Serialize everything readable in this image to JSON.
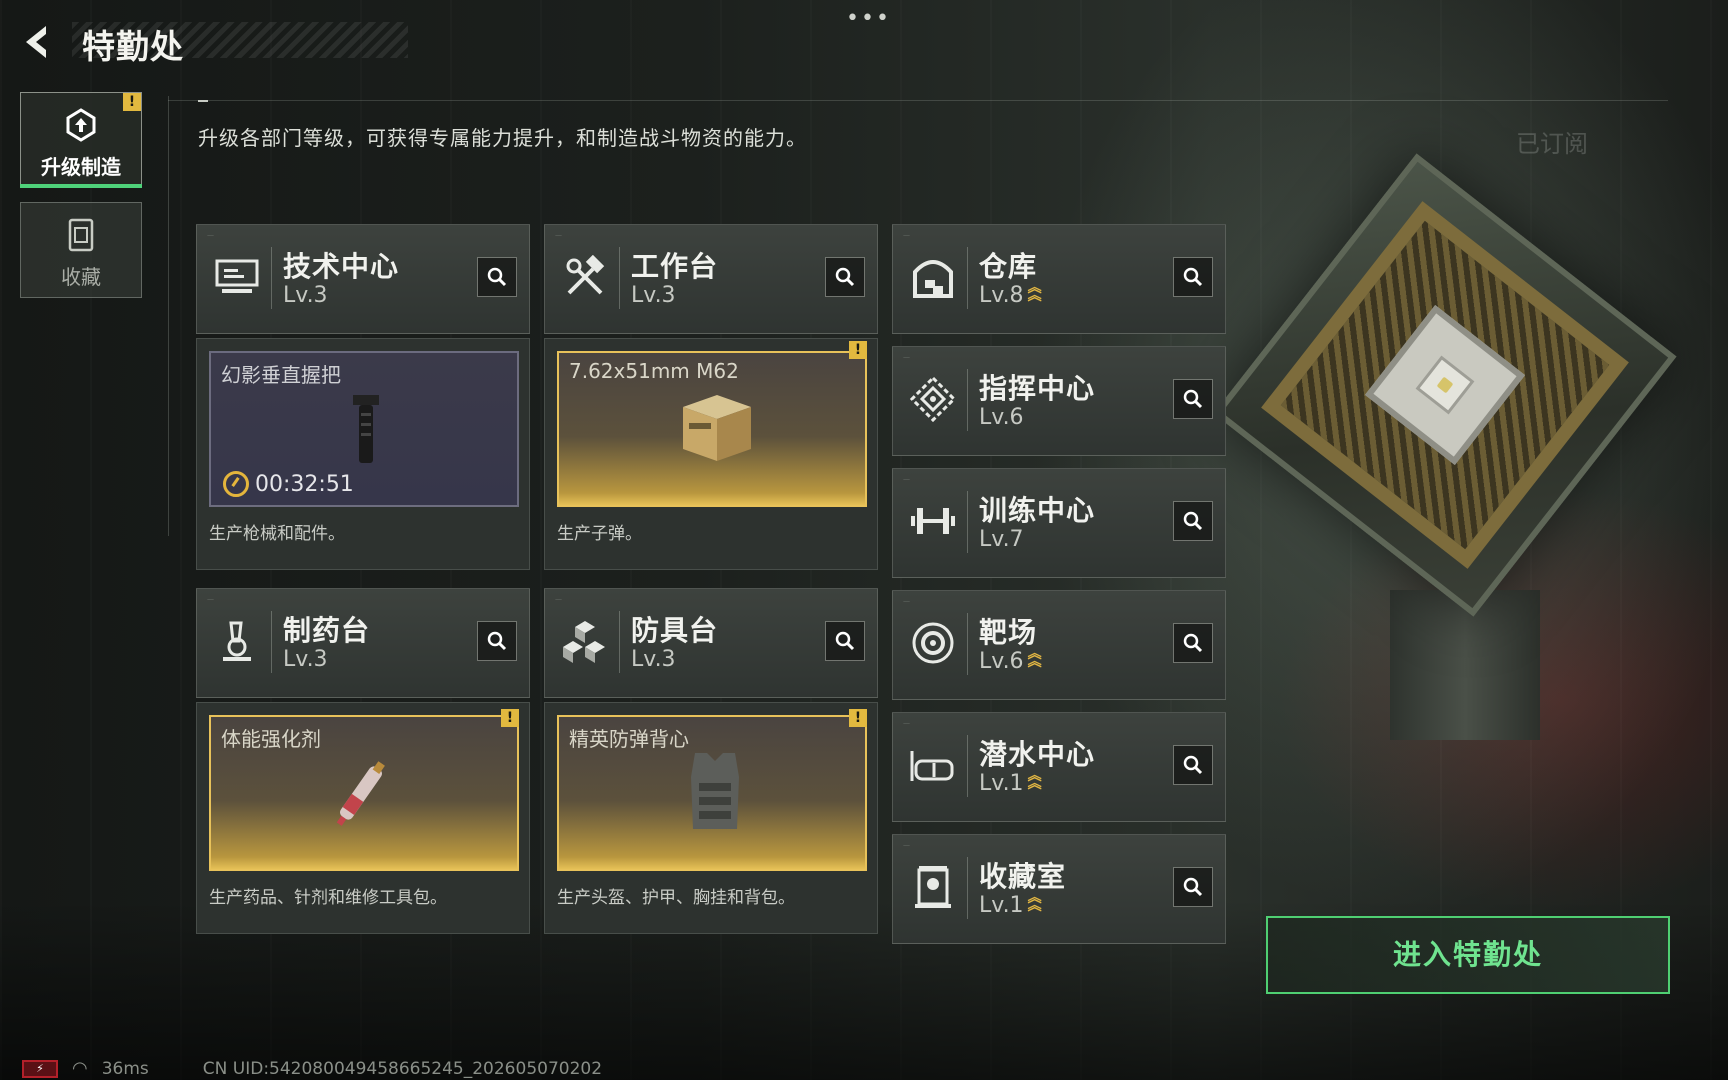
{
  "header": {
    "title": "特勤处",
    "more_label": "•••"
  },
  "nav": [
    {
      "label": "升级制造",
      "icon": "upgrade-gear-icon",
      "active": true,
      "badge": "!"
    },
    {
      "label": "收藏",
      "icon": "collection-jar-icon",
      "active": false
    }
  ],
  "description": "升级各部门等级，可获得专属能力提升，和制造战斗物资的能力。",
  "subscribed_label": "已订阅",
  "departments": {
    "tech": {
      "name": "技术中心",
      "level": "Lv.3",
      "icon": "computer-icon"
    },
    "workbench": {
      "name": "工作台",
      "level": "Lv.3",
      "icon": "hammer-wrench-icon"
    },
    "pharmacy": {
      "name": "制药台",
      "level": "Lv.3",
      "icon": "microscope-icon"
    },
    "armor": {
      "name": "防具台",
      "level": "Lv.3",
      "icon": "cubes-icon"
    },
    "storage": {
      "name": "仓库",
      "level": "Lv.8",
      "icon": "warehouse-icon",
      "upgradeable": true
    },
    "command": {
      "name": "指挥中心",
      "level": "Lv.6",
      "icon": "command-diamond-icon"
    },
    "training": {
      "name": "训练中心",
      "level": "Lv.7",
      "icon": "dumbbell-icon"
    },
    "range": {
      "name": "靶场",
      "level": "Lv.6",
      "icon": "target-icon",
      "upgradeable": true
    },
    "diving": {
      "name": "潜水中心",
      "level": "Lv.1",
      "icon": "diving-mask-icon",
      "upgradeable": true
    },
    "collection": {
      "name": "收藏室",
      "level": "Lv.1",
      "icon": "display-case-icon",
      "upgradeable": true
    }
  },
  "production": {
    "tech": {
      "item": "幻影垂直握把",
      "timer": "00:32:51",
      "desc": "生产枪械和配件。",
      "ready": false
    },
    "workbench": {
      "item": "7.62x51mm M62",
      "desc": "生产子弹。",
      "ready": true,
      "badge": "!"
    },
    "pharmacy": {
      "item": "体能强化剂",
      "desc": "生产药品、针剂和维修工具包。",
      "ready": true,
      "badge": "!"
    },
    "armor": {
      "item": "精英防弹背心",
      "desc": "生产头盔、护甲、胸挂和背包。",
      "ready": true,
      "badge": "!"
    }
  },
  "enter_button": "进入特勤处",
  "status_bar": {
    "ping": "36ms",
    "uid": "CN UID:5420800494586652​45_202605070202"
  },
  "colors": {
    "accent_green": "#4fcf72",
    "gold": "#e8c25a",
    "badge": "#e2b93f"
  }
}
